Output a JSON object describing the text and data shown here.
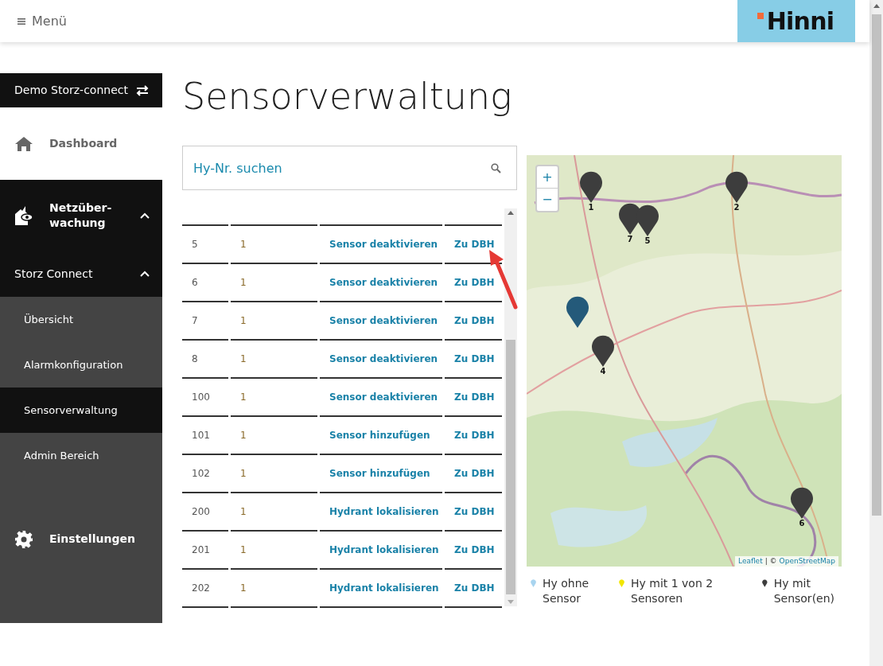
{
  "header": {
    "menu_label": "Menü",
    "logo": "Hinni"
  },
  "sidebar": {
    "account": "Demo Storz-connect",
    "items": [
      {
        "label": "Dashboard",
        "kind": "home"
      },
      {
        "label": "Netzüber-\nwachung",
        "kind": "network",
        "expanded": true,
        "children": [
          {
            "label": "Storz Connect",
            "expanded": true,
            "children": [
              {
                "label": "Übersicht",
                "selected": false
              },
              {
                "label": "Alarmkonfiguration",
                "selected": false
              },
              {
                "label": "Sensorverwaltung",
                "selected": true
              },
              {
                "label": "Admin Bereich",
                "selected": false
              }
            ]
          }
        ]
      },
      {
        "label": "Einstellungen",
        "kind": "settings"
      }
    ]
  },
  "page_title": "Sensorverwaltung",
  "search": {
    "placeholder": "Hy-Nr. suchen"
  },
  "table": {
    "rows": [
      {
        "number": "5",
        "count": "1",
        "action": "Sensor deaktivieren",
        "link": "Zu DBH"
      },
      {
        "number": "6",
        "count": "1",
        "action": "Sensor deaktivieren",
        "link": "Zu DBH"
      },
      {
        "number": "7",
        "count": "1",
        "action": "Sensor deaktivieren",
        "link": "Zu DBH"
      },
      {
        "number": "8",
        "count": "1",
        "action": "Sensor deaktivieren",
        "link": "Zu DBH"
      },
      {
        "number": "100",
        "count": "1",
        "action": "Sensor deaktivieren",
        "link": "Zu DBH"
      },
      {
        "number": "101",
        "count": "1",
        "action": "Sensor hinzufügen",
        "link": "Zu DBH"
      },
      {
        "number": "102",
        "count": "1",
        "action": "Sensor hinzufügen",
        "link": "Zu DBH"
      },
      {
        "number": "200",
        "count": "1",
        "action": "Hydrant lokalisieren",
        "link": "Zu DBH"
      },
      {
        "number": "201",
        "count": "1",
        "action": "Hydrant lokalisieren",
        "link": "Zu DBH"
      },
      {
        "number": "202",
        "count": "1",
        "action": "Hydrant lokalisieren",
        "link": "Zu DBH"
      }
    ]
  },
  "map": {
    "kind": "picture",
    "zoom_controls": [
      "+",
      "−"
    ],
    "markers": [
      {
        "label": "1",
        "color": "#3d3d3d"
      },
      {
        "label": "2",
        "color": "#3d3d3d"
      },
      {
        "label": "7",
        "color": "#3d3d3d"
      },
      {
        "label": "5",
        "color": "#3d3d3d"
      },
      {
        "color": "#245a7a"
      },
      {
        "label": "4",
        "color": "#3d3d3d"
      },
      {
        "label": "6",
        "color": "#3d3d3d"
      }
    ],
    "attribution": {
      "library": "Leaflet",
      "separator": "| ©",
      "source": "OpenStreetMap"
    }
  },
  "legend": [
    {
      "label": "Hy ohne Sensor",
      "color": "#a8d4ef"
    },
    {
      "label": "Hy mit 1 von 2 Sensoren",
      "color": "#f2e600"
    },
    {
      "label": "Hy mit Sensor(en)",
      "color": "#3d3d3d"
    }
  ]
}
